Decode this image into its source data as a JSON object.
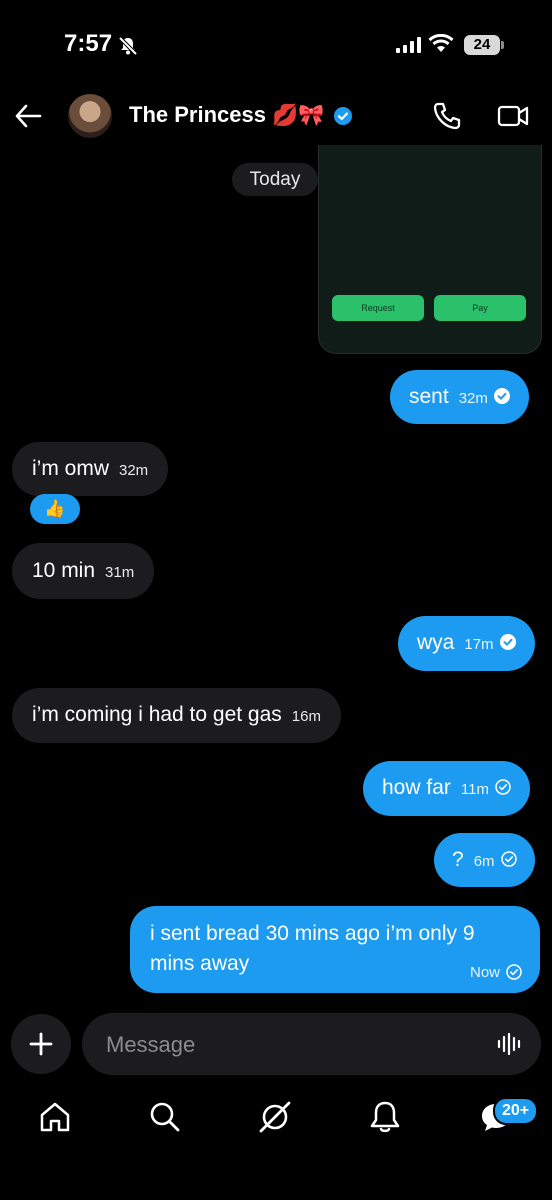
{
  "status": {
    "time": "7:57",
    "battery": "24"
  },
  "header": {
    "name": "The Princess",
    "emoji1": "💋",
    "emoji2": "🎀"
  },
  "card": {
    "request_label": "Request",
    "pay_label": "Pay"
  },
  "date_divider": "Today",
  "messages": [
    {
      "dir": "out",
      "text": "sent",
      "time": "32m",
      "status": "read"
    },
    {
      "dir": "in",
      "text": "i’m omw",
      "time": "32m",
      "reaction": "👍"
    },
    {
      "dir": "in",
      "text": "10 min",
      "time": "31m"
    },
    {
      "dir": "out",
      "text": "wya",
      "time": "17m",
      "status": "read"
    },
    {
      "dir": "in",
      "text": "i’m coming i had to get gas",
      "time": "16m"
    },
    {
      "dir": "out",
      "text": "how far",
      "time": "11m",
      "status": "sent"
    },
    {
      "dir": "out",
      "text": "?",
      "time": "6m",
      "status": "sent"
    },
    {
      "dir": "out",
      "text_line1": "i sent  bread 30 mins ago i’m only 9",
      "text_line2": "mins away",
      "time": "Now",
      "status": "sent"
    }
  ],
  "composer": {
    "placeholder": "Message"
  },
  "nav": {
    "items": [
      "home-icon",
      "search-icon",
      "grok-icon",
      "notifications-icon",
      "messages-icon"
    ],
    "messages_badge": "20+"
  },
  "colors": {
    "accent": "#1d9bf0",
    "incoming": "#1c1c1e",
    "background": "#000000",
    "pay_green": "#2bc06a"
  }
}
